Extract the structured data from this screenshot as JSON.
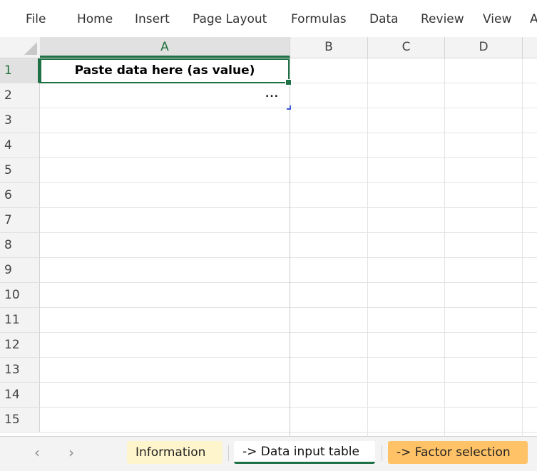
{
  "menu": [
    "File",
    "Home",
    "Insert",
    "Page Layout",
    "Formulas",
    "Data",
    "Review",
    "View",
    "A"
  ],
  "columns": [
    "A",
    "B",
    "C",
    "D"
  ],
  "rows": [
    "1",
    "2",
    "3",
    "4",
    "5",
    "6",
    "7",
    "8",
    "9",
    "10",
    "11",
    "12",
    "13",
    "14",
    "15"
  ],
  "cells": {
    "A1": "Paste data here (as value)",
    "A2_overflow": "..."
  },
  "sheet_tabs": {
    "prev_icon": "‹",
    "next_icon": "›",
    "items": [
      "Information",
      "-> Data input table",
      "-> Factor selection"
    ],
    "active_index": 1
  },
  "colors": {
    "selection": "#1e7145",
    "tab_information": "#fff5cc",
    "tab_factor": "#ffc266"
  }
}
